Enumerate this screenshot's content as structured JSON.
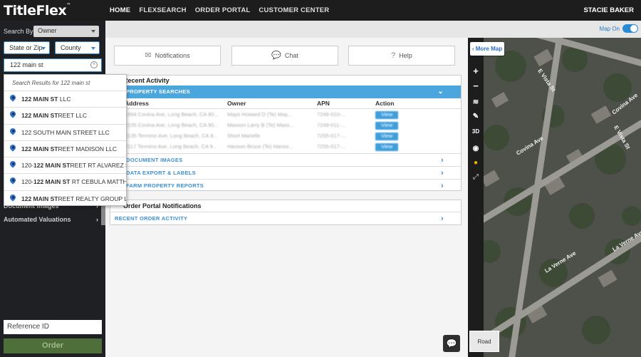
{
  "app": {
    "logo": "TitleFlex",
    "logo_mark": "™"
  },
  "nav": {
    "items": [
      "HOME",
      "FLEXSEARCH",
      "ORDER PORTAL",
      "CUSTOMER CENTER"
    ],
    "active": "HOME"
  },
  "user": {
    "name": "STACIE BAKER"
  },
  "sidebar": {
    "search_by_label": "Search By:",
    "search_by_value": "Owner",
    "state_zip": "State or Zip",
    "county": "County",
    "search_value": "122 main st",
    "items": [
      {
        "label": "Document Images"
      },
      {
        "label": "Automated Valuations"
      }
    ],
    "reference_id_placeholder": "Reference ID",
    "order_button": "Order"
  },
  "dropdown": {
    "header": "Search Results for 122 main st",
    "results": [
      {
        "bold": "122 MAIN ST",
        "rest": " LLC",
        "pre": ""
      },
      {
        "bold": "122 MAIN ST",
        "rest": "REET LLC",
        "pre": ""
      },
      {
        "bold": "",
        "rest": "122 SOUTH MAIN STREET LLC",
        "pre": ""
      },
      {
        "bold": "122 MAIN ST",
        "rest": "REET MADISON LLC",
        "pre": ""
      },
      {
        "pre": "120-",
        "bold": "122 MAIN ST",
        "rest": "REET RT ALVAREZ BLANCA"
      },
      {
        "pre": "120-",
        "bold": "122 MAIN ST",
        "rest": " RT CEBULA MATTHEW"
      },
      {
        "bold": "122 MAIN ST",
        "rest": "REET REALTY GROUP LLC",
        "pre": ""
      }
    ]
  },
  "map_toggle": {
    "label": "Map On",
    "on": true
  },
  "quick": {
    "notifications": "Notifications",
    "chat": "Chat",
    "help": "Help"
  },
  "recent_activity": {
    "title": "Recent Activity",
    "property_searches": "PROPERTY SEARCHES",
    "headers": {
      "address": "Address",
      "owner": "Owner",
      "apn": "APN",
      "action": "Action"
    },
    "rows": [
      {
        "address": "1994 Covina Ave, Long Beach, CA 90...",
        "owner": "Mayo Howard D (Te) May...",
        "apn": "7249-010-...",
        "action": "View"
      },
      {
        "address": "2105 Covina Ave, Long Beach, CA 90...",
        "owner": "Maxson Larry B (Te) Maxs...",
        "apn": "7249-011-...",
        "action": "View"
      },
      {
        "address": "2135 Termino Ave, Long Beach, CA 9...",
        "owner": "Short Marielle",
        "apn": "7255-017-...",
        "action": "View"
      },
      {
        "address": "2117 Termino Ave, Long Beach, CA 9...",
        "owner": "Hanson Bruce (Te) Hanso...",
        "apn": "7255-017-...",
        "action": "View"
      }
    ],
    "links": [
      "DOCUMENT IMAGES",
      "DATA EXPORT & LABELS",
      "FARM PROPERTY REPORTS"
    ]
  },
  "order_portal": {
    "title": "Order Portal Notifications",
    "link": "RECENT ORDER ACTIVITY"
  },
  "map": {
    "more_map": "More Map",
    "road": "Road",
    "streets": [
      "E Vista St",
      "Covina Ave",
      "E Vista St",
      "Covina Ave",
      "La Verne Ave",
      "La Verne Ave"
    ],
    "controls": [
      "+",
      "−",
      "layers",
      "ruler",
      "3D",
      "globe",
      "pegman",
      "expand"
    ]
  }
}
